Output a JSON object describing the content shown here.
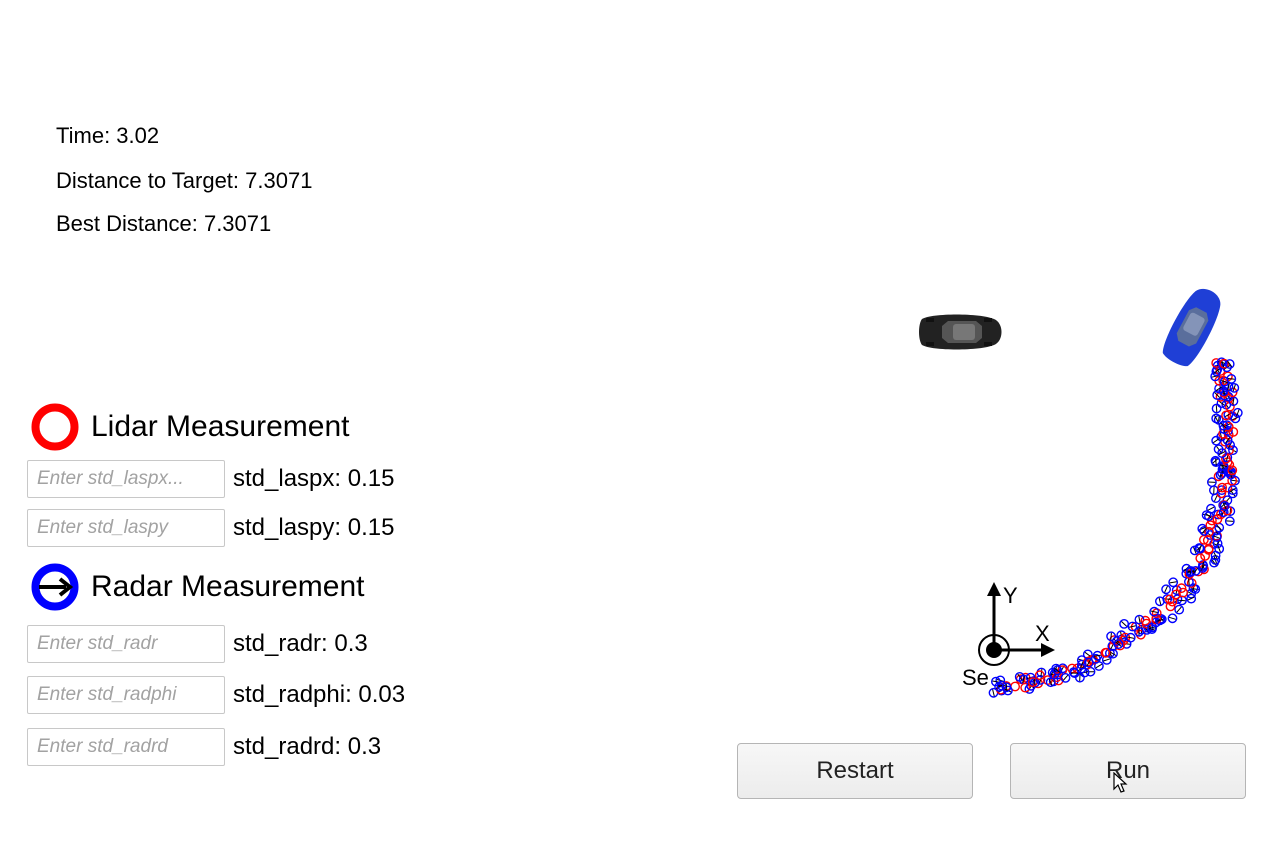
{
  "stats": {
    "time": "Time: 3.02",
    "distance": "Distance to Target: 7.3071",
    "best": "Best Distance: 7.3071"
  },
  "lidar": {
    "title": "Lidar Measurement",
    "icon": "red-ring-icon",
    "color": "#ff0000",
    "fields": [
      {
        "placeholder": "Enter std_laspx...",
        "label": "std_laspx: 0.15"
      },
      {
        "placeholder": "Enter std_laspy",
        "label": "std_laspy: 0.15"
      }
    ]
  },
  "radar": {
    "title": "Radar Measurement",
    "icon": "blue-ring-arrow-icon",
    "color": "#0000ff",
    "fields": [
      {
        "placeholder": "Enter std_radr",
        "label": "std_radr: 0.3"
      },
      {
        "placeholder": "Enter std_radphi",
        "label": "std_radphi: 0.03"
      },
      {
        "placeholder": "Enter std_radrd",
        "label": "std_radrd: 0.3"
      }
    ]
  },
  "scene": {
    "axis_x": "X",
    "axis_y": "Y",
    "sensor_label": "Se",
    "target_car_color": "#2a2a2a",
    "hunter_car_color": "#1f3fd6"
  },
  "buttons": {
    "restart": "Restart",
    "run": "Run"
  }
}
